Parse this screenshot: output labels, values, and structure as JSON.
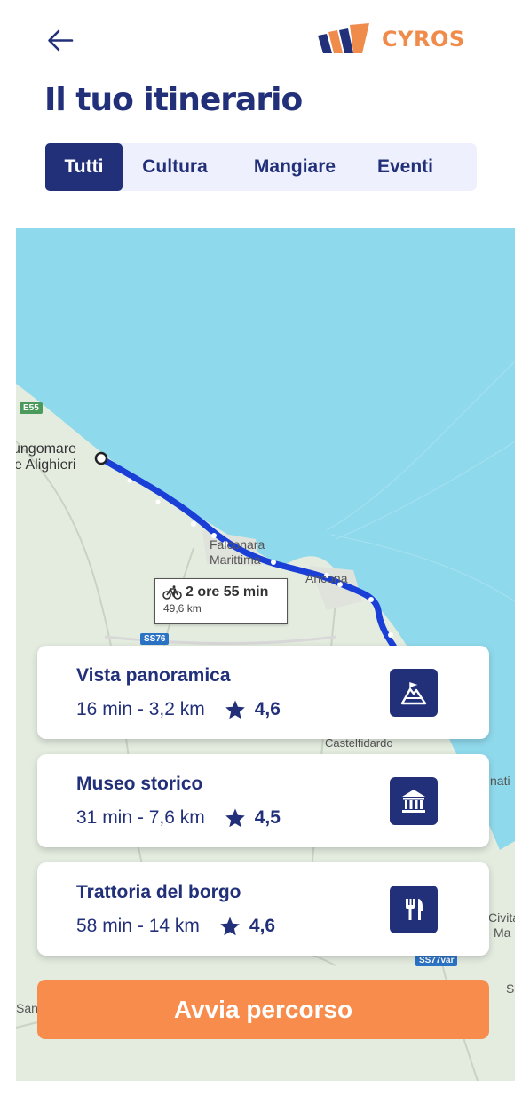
{
  "header": {
    "brand_name": "CYROS",
    "title": "Il tuo itinerario"
  },
  "tabs": [
    {
      "label": "Tutti",
      "active": true
    },
    {
      "label": "Cultura",
      "active": false
    },
    {
      "label": "Mangiare",
      "active": false
    },
    {
      "label": "Eventi",
      "active": false
    }
  ],
  "map": {
    "labels": {
      "start_line1": "ungomare",
      "start_line2": "e Alighieri",
      "falconara_line1": "Falconara",
      "falconara_line2": "Marittima",
      "ancona": "Ancona",
      "castelfidardo": "Castelfidardo",
      "right_edge_1": "nati",
      "right_edge_2a": "Civita",
      "right_edge_2b": "Ma",
      "right_edge_3": "S",
      "left_edge": "San"
    },
    "road_shields": {
      "e55": "E55",
      "ss76": "SS76",
      "ss77var": "SS77var"
    },
    "route": {
      "time": "2 ore 55 min",
      "distance": "49,6 km",
      "mode_icon": "bicycle-icon"
    }
  },
  "cards": [
    {
      "name": "Vista panoramica",
      "meta": "16 min - 3,2 km",
      "rating": "4,6",
      "icon": "viewpoint-icon"
    },
    {
      "name": "Museo storico",
      "meta": "31 min - 7,6 km",
      "rating": "4,5",
      "icon": "museum-icon"
    },
    {
      "name": "Trattoria del borgo",
      "meta": "58 min - 14 km",
      "rating": "4,6",
      "icon": "restaurant-icon"
    }
  ],
  "cta": {
    "label": "Avvia percorso"
  },
  "colors": {
    "primary": "#22307a",
    "accent": "#f78c4c",
    "route": "#1a3fd6",
    "sea": "#8fd9ec"
  }
}
